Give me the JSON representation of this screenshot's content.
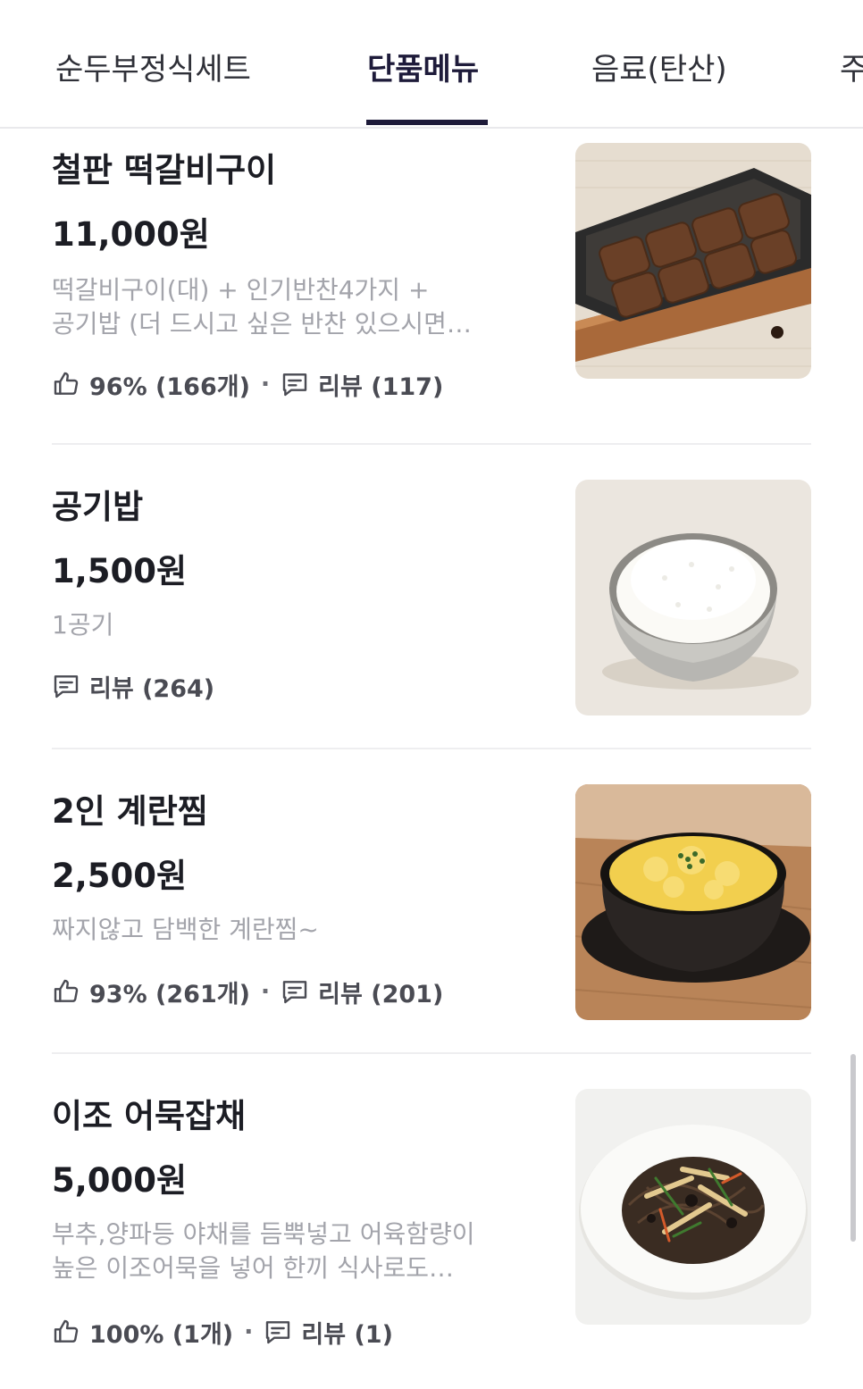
{
  "tabs": [
    {
      "label": "순두부정식세트",
      "active": false
    },
    {
      "label": "단품메뉴",
      "active": true
    },
    {
      "label": "음료(탄산)",
      "active": false
    },
    {
      "label": "주",
      "active": false
    }
  ],
  "items": [
    {
      "name": "철판 떡갈비구이",
      "price": "11,000원",
      "desc_lines": [
        "떡갈비구이(대) + 인기반찬4가지 +",
        "공기밥 (더 드시고 싶은 반찬 있으시면…"
      ],
      "like_text": "96% (166개)",
      "separator": "·",
      "review_text": "리뷰 (117)",
      "image": "grilled-tteokgalbi-photo"
    },
    {
      "name": "공기밥",
      "price": "1,500원",
      "desc_lines": [
        "1공기"
      ],
      "review_text": "리뷰 (264)",
      "image": "rice-bowl-photo"
    },
    {
      "name": "2인 계란찜",
      "price": "2,500원",
      "desc_lines": [
        "짜지않고 담백한 계란찜~"
      ],
      "like_text": "93% (261개)",
      "separator": "·",
      "review_text": "리뷰 (201)",
      "image": "steamed-egg-photo"
    },
    {
      "name": "이조 어묵잡채",
      "price": "5,000원",
      "desc_lines": [
        "부추,양파등 야채를 듬뿍넣고 어육함량이",
        "높은 이조어묵을 넣어 한끼 식사로도…"
      ],
      "like_text": "100% (1개)",
      "separator": "·",
      "review_text": "리뷰 (1)",
      "image": "fishcake-japchae-photo"
    }
  ],
  "icons": {
    "like": "thumbs-up-icon",
    "review": "chat-bubble-icon"
  },
  "colors": {
    "text": "#1c1d24",
    "muted": "#a3a4ab",
    "accent": "#1e1b3a"
  }
}
